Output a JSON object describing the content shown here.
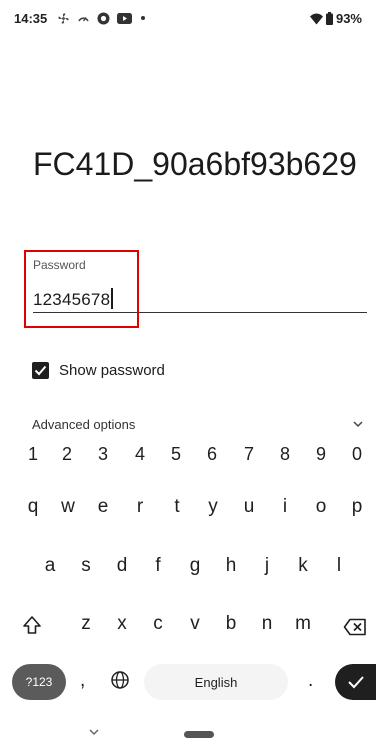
{
  "status_bar": {
    "time": "14:35",
    "battery": "93%",
    "icons": [
      "fan-icon",
      "gauge-icon",
      "headset-icon",
      "youtube-icon",
      "dot-icon"
    ],
    "right_icons": [
      "wifi-icon",
      "battery-icon"
    ]
  },
  "network": {
    "name": "FC41D_90a6bf93b629"
  },
  "password": {
    "label": "Password",
    "value": "12345678"
  },
  "show_password": {
    "label": "Show password",
    "checked": true
  },
  "advanced": {
    "label": "Advanced options"
  },
  "keyboard": {
    "number_row": [
      "1",
      "2",
      "3",
      "4",
      "5",
      "6",
      "7",
      "8",
      "9",
      "0"
    ],
    "row1": [
      "q",
      "w",
      "e",
      "r",
      "t",
      "y",
      "u",
      "i",
      "o",
      "p"
    ],
    "row2": [
      "a",
      "s",
      "d",
      "f",
      "g",
      "h",
      "j",
      "k",
      "l"
    ],
    "row3": [
      "z",
      "x",
      "c",
      "v",
      "b",
      "n",
      "m"
    ],
    "symbols_label": "?123",
    "comma": ",",
    "space_label": "English",
    "period": ".",
    "shift_icon": "shift-icon",
    "backspace_icon": "backspace-icon",
    "globe_icon": "globe-icon",
    "enter_icon": "check-icon"
  },
  "colors": {
    "highlight": "#e00000",
    "enter_key": "#1f1f1f",
    "symbols_key": "#5b5b5b"
  }
}
